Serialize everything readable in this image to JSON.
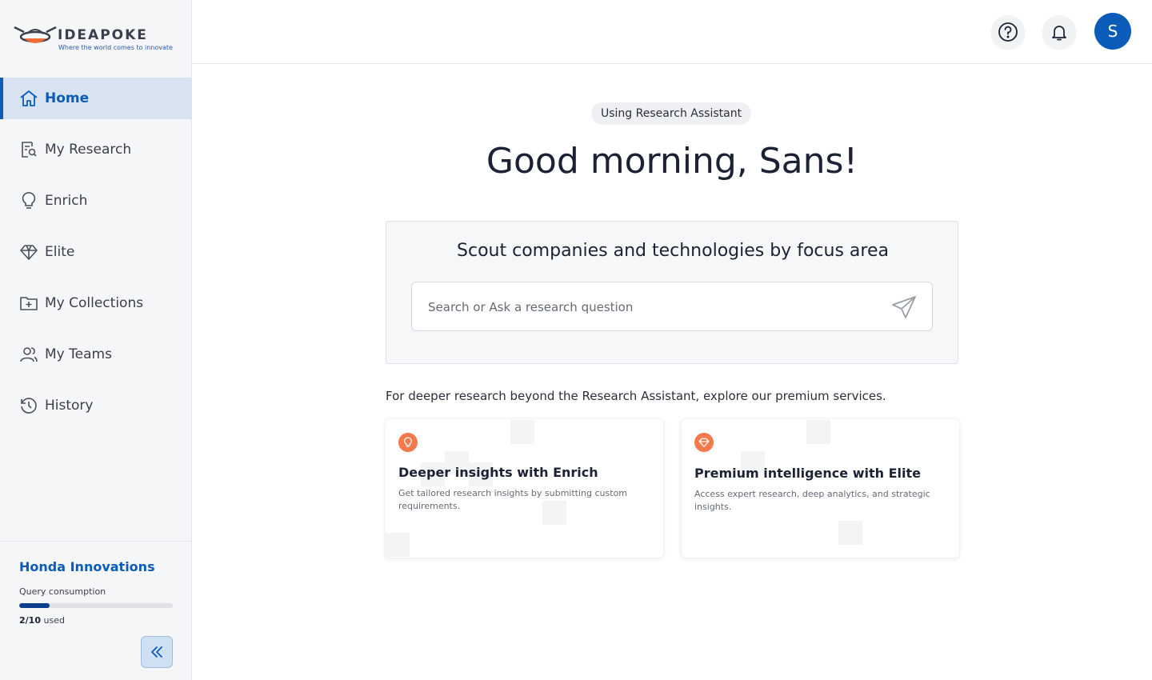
{
  "brand": {
    "name": "IDEAPOKE",
    "tagline": "Where the world comes to innovate",
    "primary_color": "#0b5cb8",
    "accent_color": "#f26b3a"
  },
  "sidebar": {
    "items": [
      {
        "label": "Home",
        "icon": "home-icon",
        "active": true
      },
      {
        "label": "My Research",
        "icon": "research-icon",
        "active": false
      },
      {
        "label": "Enrich",
        "icon": "lightbulb-icon",
        "active": false
      },
      {
        "label": "Elite",
        "icon": "diamond-icon",
        "active": false
      },
      {
        "label": "My Collections",
        "icon": "folder-plus-icon",
        "active": false
      },
      {
        "label": "My Teams",
        "icon": "team-icon",
        "active": false
      },
      {
        "label": "History",
        "icon": "history-icon",
        "active": false
      }
    ],
    "footer": {
      "org_name": "Honda Innovations",
      "quota_label": "Query consumption",
      "quota_used_value": "2/10",
      "quota_used_suffix": " used",
      "quota_fraction": 0.2,
      "collapse_icon": "double-chevron-left-icon"
    }
  },
  "header": {
    "help_icon": "help-icon",
    "notification_icon": "bell-icon",
    "avatar_initial": "S"
  },
  "main": {
    "mode_pill": "Using Research Assistant",
    "greeting": "Good morning, Sans!",
    "search": {
      "title": "Scout companies and technologies by focus area",
      "placeholder": "Search or Ask a research question",
      "value": "",
      "send_icon": "send-icon"
    },
    "premium_intro": "For deeper research beyond the Research Assistant, explore our premium services.",
    "services": [
      {
        "title": "Deeper insights with Enrich",
        "description": "Get tailored research insights by submitting custom requirements.",
        "icon": "lightbulb-icon"
      },
      {
        "title": "Premium intelligence with Elite",
        "description": "Access expert research, deep analytics, and strategic insights.",
        "icon": "diamond-icon"
      }
    ]
  }
}
